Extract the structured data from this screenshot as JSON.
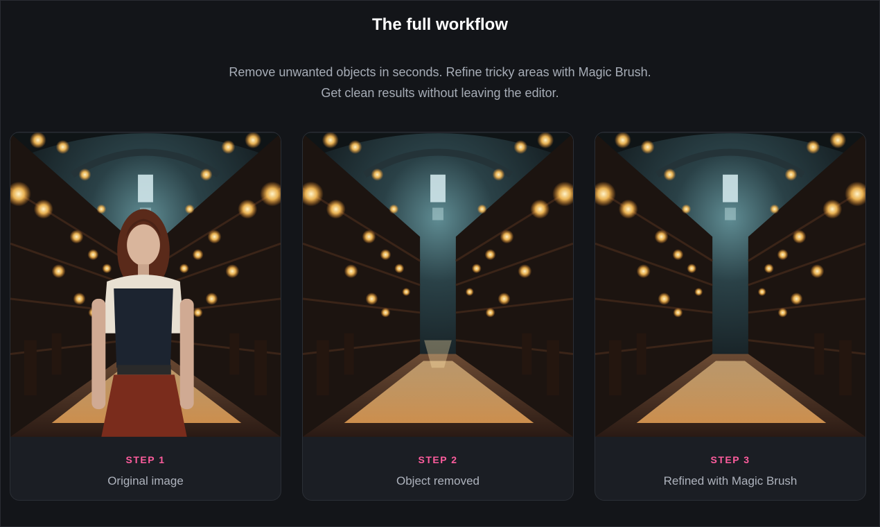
{
  "page": {
    "title": "The full workflow",
    "subtitle_lines": [
      "Remove unwanted objects in seconds. Refine tricky areas with Magic Brush.",
      "Get clean results without leaving the editor."
    ]
  },
  "steps": [
    {
      "step": "STEP 1",
      "label": "Original image",
      "image": "library-corridor-with-woman"
    },
    {
      "step": "STEP 2",
      "label": "Object removed",
      "image": "library-corridor-empty"
    },
    {
      "step": "STEP 3",
      "label": "Refined with Magic Brush",
      "image": "library-corridor-refined"
    }
  ],
  "colors": {
    "background": "#131519",
    "card": "#1b1e24",
    "accent": "#ff5d9e",
    "title": "#ffffff",
    "muted": "#aeb3bd"
  }
}
